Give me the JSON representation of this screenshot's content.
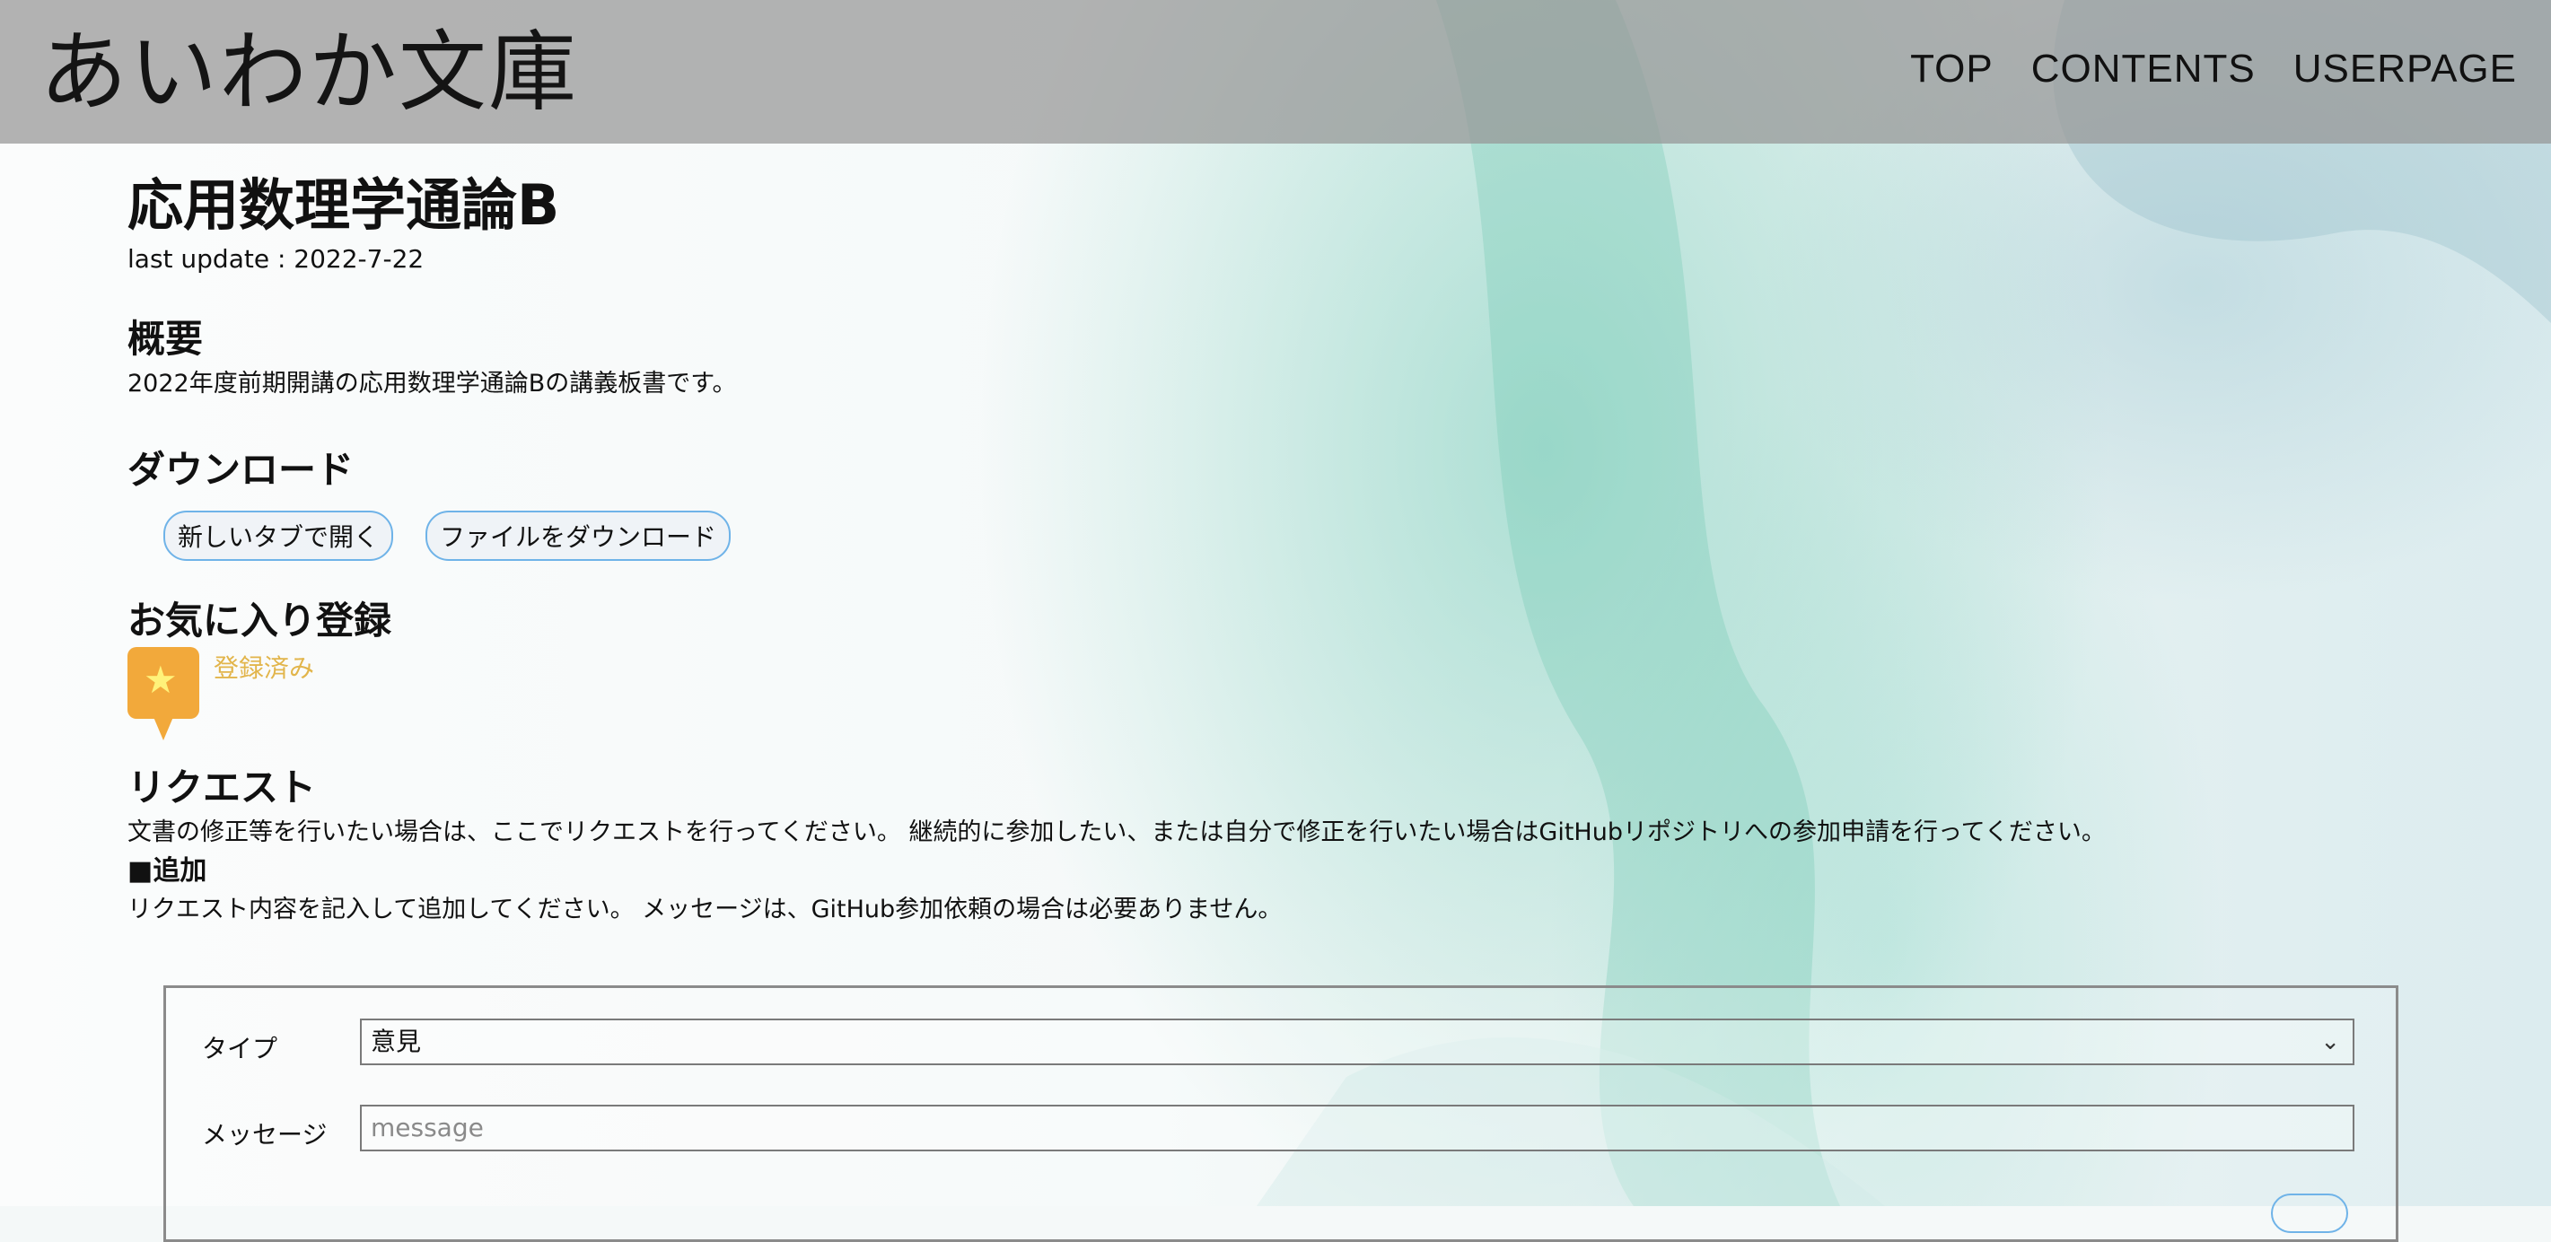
{
  "header": {
    "site_title": "あいわか文庫",
    "nav": [
      "TOP",
      "CONTENTS",
      "USERPAGE"
    ]
  },
  "doc": {
    "title": "応用数理学通論B",
    "last_update": "last update : 2022-7-22"
  },
  "overview": {
    "heading": "概要",
    "text": "2022年度前期開講の応用数理学通論Bの講義板書です。"
  },
  "download": {
    "heading": "ダウンロード",
    "open_new_tab": "新しいタブで開く",
    "download_file": "ファイルをダウンロード"
  },
  "favorite": {
    "heading": "お気に入り登録",
    "status": "登録済み",
    "colors": {
      "bubble": "#f2a93b",
      "star": "#fff27a",
      "label": "#e2b54b"
    }
  },
  "request": {
    "heading": "リクエスト",
    "description": "文書の修正等を行いたい場合は、ここでリクエストを行ってください。 継続的に参加したい、または自分で修正を行いたい場合はGitHubリポジトリへの参加申請を行ってください。",
    "add_heading": "■追加",
    "add_text": "リクエスト内容を記入して追加してください。 メッセージは、GitHub参加依頼の場合は必要ありません。",
    "form": {
      "type_label": "タイプ",
      "type_value": "意見",
      "message_label": "メッセージ",
      "message_placeholder": "message"
    }
  }
}
